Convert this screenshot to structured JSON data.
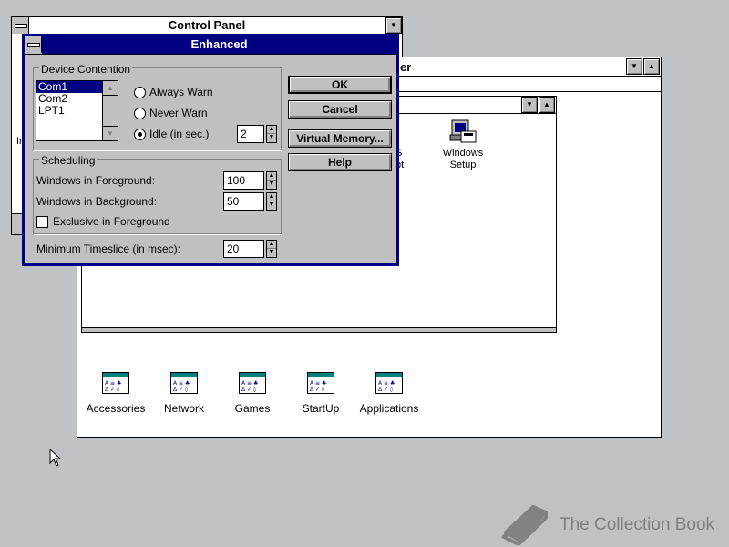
{
  "control_panel": {
    "title": "Control Panel"
  },
  "program_manager": {
    "title_fragment": "er",
    "groups": [
      {
        "label": "Accessories"
      },
      {
        "label": "Network"
      },
      {
        "label": "Games"
      },
      {
        "label": "StartUp"
      },
      {
        "label": "Applications"
      }
    ],
    "inner_window": {
      "items": [
        {
          "label": "S\npt"
        },
        {
          "label": "Windows\nSetup"
        }
      ]
    },
    "left_fragment": "In"
  },
  "dialog": {
    "title": "Enhanced",
    "device_contention": {
      "label": "Device Contention",
      "ports": [
        "Com1",
        "Com2",
        "LPT1"
      ],
      "selected_port": "Com1",
      "options": [
        "Always Warn",
        "Never Warn",
        "Idle (in sec.)"
      ],
      "selected_option": "Idle (in sec.)",
      "idle_value": "2"
    },
    "scheduling": {
      "label": "Scheduling",
      "foreground_label": "Windows in Foreground:",
      "foreground_value": "100",
      "background_label": "Windows in Background:",
      "background_value": "50",
      "exclusive_label": "Exclusive in Foreground",
      "exclusive_checked": false
    },
    "timeslice_label": "Minimum Timeslice (in msec):",
    "timeslice_value": "20",
    "buttons": {
      "ok": "OK",
      "cancel": "Cancel",
      "virtual_memory": "Virtual Memory...",
      "help": "Help"
    }
  },
  "watermark": {
    "text": "The Collection Book"
  }
}
